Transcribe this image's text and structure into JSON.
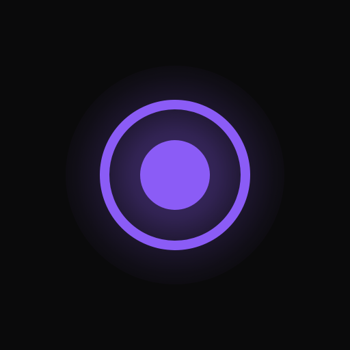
{
  "colors": {
    "background": "#0a0a0b",
    "accent": "#8b5cf6"
  },
  "icon": {
    "name": "record-icon",
    "ring": "ring",
    "dot": "filled-circle"
  }
}
